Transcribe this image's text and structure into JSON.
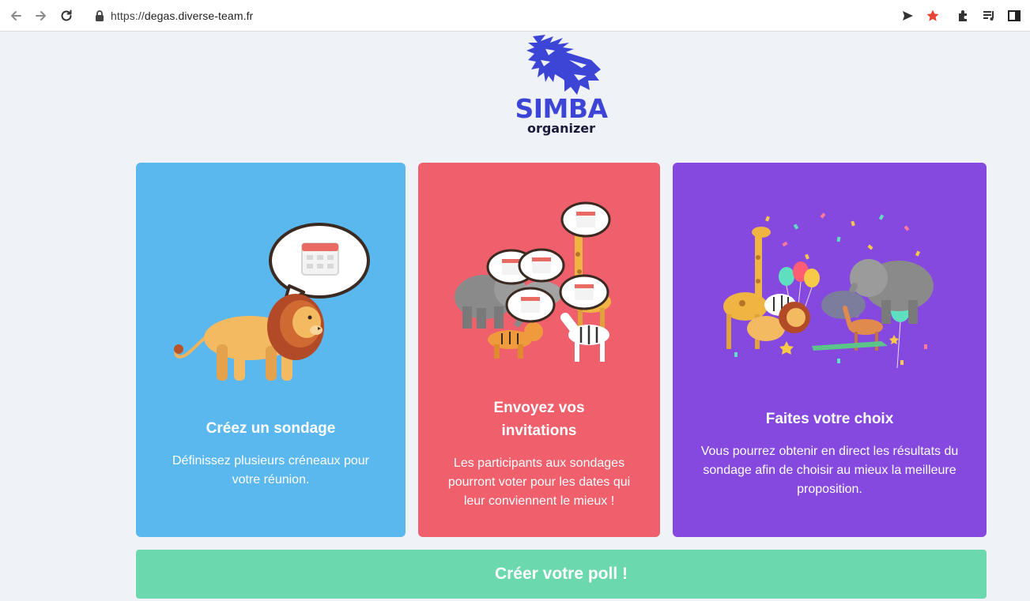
{
  "browser": {
    "url_scheme": "https://",
    "url_host": "degas.diverse-team.fr",
    "star_color": "#ea4335"
  },
  "logo": {
    "name": "SIMBA",
    "subtitle": "organizer",
    "brand_color": "#3d45d6"
  },
  "cards": [
    {
      "title": "Créez un sondage",
      "text": "Définissez plusieurs créneaux pour votre réunion.",
      "color": "#5bb8ef",
      "illustration": "lion-with-calendar-bubble"
    },
    {
      "title_line1": "Envoyez vos",
      "title_line2": "invitations",
      "text": "Les participants aux sondages pourront voter pour les dates qui leur conviennent le mieux !",
      "color": "#ef5f6c",
      "illustration": "animals-with-calendar-bubbles"
    },
    {
      "title": "Faites votre choix",
      "text": "Vous pourrez obtenir en direct les résultats du sondage afin de choisir au mieux la meilleure proposition.",
      "color": "#8549e0",
      "illustration": "animals-party-confetti"
    }
  ],
  "cta": {
    "label": "Créer votre poll !",
    "color": "#6bd8ae"
  }
}
